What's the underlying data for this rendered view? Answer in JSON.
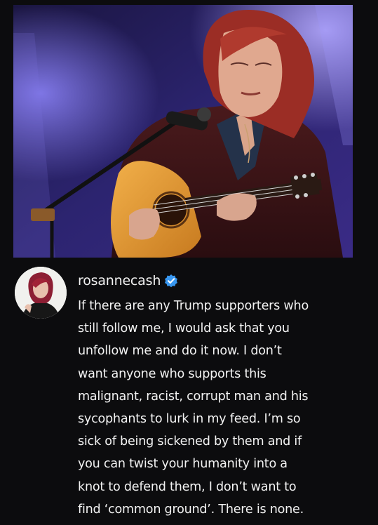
{
  "post": {
    "username": "rosannecash",
    "verified": true,
    "caption": "If there are any Trump supporters who\nstill follow me, I would ask that you\nunfollow me and do it now. I don’t\nwant anyone who supports this\nmalignant, racist, corrupt man and his\nsycophants to lurk in my feed. I’m so\nsick of being sickened by them and if\nyou can twist your humanity into a\nknot to defend them, I don’t want to\nfind ‘common ground’. There is none."
  },
  "icons": {
    "verified_badge": "verified-check-icon"
  },
  "colors": {
    "background": "#0c0c0e",
    "text": "#f2f2f2",
    "verified": "#3897f0",
    "stage_purple": "#3b2f8f"
  }
}
